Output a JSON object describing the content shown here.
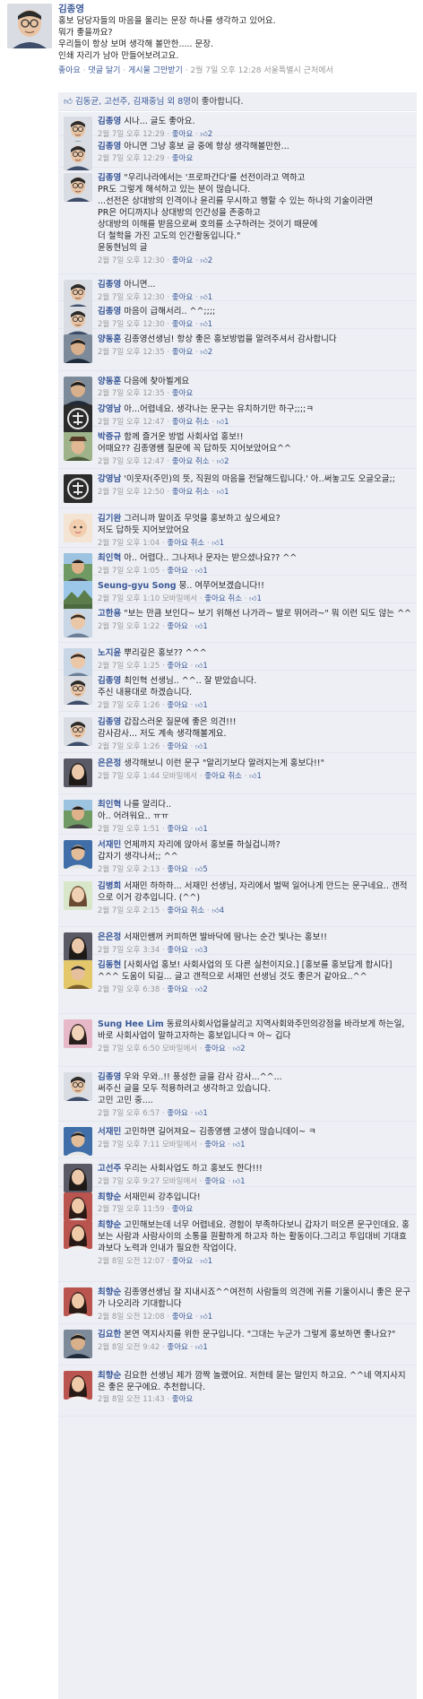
{
  "post": {
    "author": "김종영",
    "text": "홍보 담당자들의 마음을 울리는 문장 하나를 생각하고 있어요.\n뭐가 좋을까요?\n우리들이 항상 보며 생각해 볼만한..... 문장.\n인쇄 자리가 남아 만들어보려고요.",
    "actions": {
      "like": "좋아요",
      "comment": "댓글 달기",
      "unfollow": "게시물 그만받기",
      "time": "2월 7일 오후 12:28",
      "place": "서울특별시 근처에서"
    }
  },
  "likes_bar": {
    "names": "김동균, 고선주, 김재중님",
    "others": "외 8명",
    "suffix": "이 좋아합니다."
  },
  "colors": {
    "link": "#3b5998",
    "comment_bg": "#edeff4",
    "meta": "#999999"
  },
  "comments": [
    {
      "author": "김종영",
      "text": "시나... 글도 좋아요.",
      "time": "2월 7일 오후 12:29",
      "like": "좋아요",
      "count": "2",
      "avatar": "man-glasses"
    },
    {
      "author": "김종영",
      "text": "아니면 그냥 홍보 글 중에 항상 생각해볼만한...",
      "time": "2월 7일 오후 12:29",
      "like": "좋아요",
      "count": "",
      "avatar": "man-glasses"
    },
    {
      "author": "김종영",
      "text": "\"우리나라에서는 '프로파간다'를 선전이라고 역하고\nPR도 그렇게 해석하고 있는 분이 많습니다.\n...선전은 상대방의 인격이나 윤리를 무시하고 행할 수 있는 하나의 기술이라면\nPR은 어디까지나 상대방의 인간성을 존중하고\n상대방의 이해를 받음으로써 호의를 소구하려는 것이기 때문에\n더 철학을 가진 고도의 인간활동입니다.\"\n윤동현님의 글",
      "time": "2월 7일 오후 12:30",
      "like": "좋아요",
      "count": "2",
      "avatar": "man-glasses"
    },
    {
      "author": "김종영",
      "text": "아니면...",
      "time": "2월 7일 오후 12:30",
      "like": "좋아요",
      "count": "1",
      "avatar": "man-glasses"
    },
    {
      "author": "김종영",
      "text": "마음이 급해서리.. ^^;;;;",
      "time": "2월 7일 오후 12:30",
      "like": "좋아요",
      "count": "1",
      "avatar": "man-glasses"
    },
    {
      "author": "양동훈",
      "text": "김종영선생님! 항상 좋은 홍보방법을 알려주셔서 감사합니다",
      "time": "2월 7일 오후 12:35",
      "like": "좋아요",
      "count": "2",
      "avatar": "man-dark"
    },
    {
      "author": "양동훈",
      "text": "다음에 찾아뵐게요",
      "time": "2월 7일 오후 12:35",
      "like": "좋아요",
      "count": "",
      "avatar": "man-dark"
    },
    {
      "author": "강영남",
      "text": "아...어렵네요. 생각나는 문구는 유치하기만 하구;;;;ㅋ",
      "time": "2월 7일 오후 12:47",
      "like": "좋아요 취소",
      "count": "1",
      "avatar": "logo-dark"
    },
    {
      "author": "박증규",
      "text": "함께 즐거운 방법 사회사업 홍보!!\n어때요?? 김종영쌤 질문에 꼭 답하듯 지어보았어요^^",
      "time": "2월 7일 오후 12:47",
      "like": "좋아요 취소",
      "count": "2",
      "avatar": "man-hat"
    },
    {
      "author": "강영남",
      "text": "'이웃자(주민)의 뜻, 직원의 마음을 전달해드립니다.' 아..써놓고도 오글오글;;",
      "time": "2월 7일 오후 12:50",
      "like": "좋아요 취소",
      "count": "1",
      "avatar": "logo-dark"
    },
    {
      "author": "김기완",
      "text": "그러니까 말이죠 무엇을 홍보하고 싶으세요?\n저도 답하듯 지어보았어요",
      "time": "2월 7일 오후 1:04",
      "like": "좋아요 취소",
      "count": "1",
      "avatar": "baby"
    },
    {
      "author": "최인혁",
      "text": "아.. 어렵다.. 그나저나 문자는 받으셨나요?? ^^",
      "time": "2월 7일 오후 1:05",
      "like": "좋아요",
      "count": "1",
      "avatar": "man-outdoor"
    },
    {
      "author": "Seung-gyu Song",
      "text": "뭉.. 여쭈어보겠습니다!!",
      "time": "2월 7일 오후 1:10 모바일에서",
      "like": "좋아요 취소",
      "count": "1",
      "avatar": "landscape"
    },
    {
      "author": "고한용",
      "text": "\"보는 만큼 보인다~ 보기 위해선 나가라~ 발로 뛰어라~\" 뭐 이런 되도 않는 ^^",
      "time": "2월 7일 오후 1:22",
      "like": "좋아요",
      "count": "1",
      "avatar": "man-light"
    },
    {
      "author": "노지윤",
      "text": "뿌리깊은 홍보?? ^^^",
      "time": "2월 7일 오후 1:25",
      "like": "좋아요",
      "count": "1",
      "avatar": "man-light"
    },
    {
      "author": "김종영",
      "text": "최인혁 선생님.. ^^.. 잘 받았습니다.\n주신 내용대로 하겠습니다.",
      "time": "2월 7일 오후 1:26",
      "like": "좋아요",
      "count": "1",
      "avatar": "man-glasses"
    },
    {
      "author": "김종영",
      "text": "갑잡스러운 질문에 좋은 의견!!!\n감사감사... 저도 계속 생각해볼게요.",
      "time": "2월 7일 오후 1:26",
      "like": "좋아요",
      "count": "1",
      "avatar": "man-glasses"
    },
    {
      "author": "은은정",
      "text": "생각해보니 이런 문구 \"알리기보다 알려지는게 홍보다!!\"",
      "time": "2월 7일 오후 1:44 모바일에서",
      "like": "좋아요 취소",
      "count": "1",
      "avatar": "woman-dark"
    },
    {
      "author": "최인혁",
      "text": "나를 알리다..\n아.. 어려워요.. ㅠㅠ",
      "time": "2월 7일 오후 1:51",
      "like": "좋아요",
      "count": "1",
      "avatar": "man-outdoor"
    },
    {
      "author": "서재민",
      "text": "언제까지 자리에 앉아서 홍보를 하실겁니까?\n갑자기 생각나서;; ^^",
      "time": "2월 7일 오후 2:13",
      "like": "좋아요",
      "count": "5",
      "avatar": "man-blue"
    },
    {
      "author": "김병희",
      "text": "서재민 하하하... 서재민 선생님, 자리에서 벌떡 일어나게 만드는 문구네요.. 갠적으로 이거 강추입니다. (^^)",
      "time": "2월 7일 오후 2:15",
      "like": "좋아요 취소",
      "count": "4",
      "avatar": "woman-light"
    },
    {
      "author": "은은정",
      "text": "서재민쌤꺼 커피하면 발바닥에 땀나는 순간 빛나는 홍보!!",
      "time": "2월 7일 오후 3:34",
      "like": "좋아요",
      "count": "3",
      "avatar": "woman-dark"
    },
    {
      "author": "김동현",
      "text": "[사회사업 홍보! 사회사업의 또 다른 실천이지요.] [홍보를 홍보답게 합시다] ^^^ 도움이 되길... 글고 갠적으로 서재민 선생님 것도 좋은거 같아요..^^",
      "time": "2월 7일 오후 6:38",
      "like": "좋아요",
      "count": "2",
      "avatar": "man-yellow"
    },
    {
      "author": "Sung Hee Lim",
      "text": "동료의사회사업을살리고 지역사회와주민의강점을 바라보게 하는일, 바로 사회사업이 말하고자하는 홍보입니다ㅋ 아~ 깁다",
      "time": "2월 7일 오후 6:50 모바일에서",
      "like": "좋아요",
      "count": "2",
      "avatar": "woman-pink"
    },
    {
      "author": "김종영",
      "text": "우와 우와..!! 풍성한 글을 감사 감사...^^...\n써주신 글을 모두 적용하려고 생각하고 있습니다.\n고민 고민 중....",
      "time": "2월 7일 오후 6:57",
      "like": "좋아요",
      "count": "1",
      "avatar": "man-glasses"
    },
    {
      "author": "서재민",
      "text": "고민하면 길어져요~ 김종영쌤 고생이 많습니데이~ ㅋ",
      "time": "2월 7일 오후 7:11 모바일에서",
      "like": "좋아요",
      "count": "1",
      "avatar": "man-blue"
    },
    {
      "author": "고선주",
      "text": "우리는 사회사업도 하고 홍보도 한다!!!",
      "time": "2월 7일 오후 9:27 모바일에서",
      "like": "좋아요",
      "count": "1",
      "avatar": "woman-dark"
    },
    {
      "author": "최향순",
      "text": "서재민씨 강추입니다!",
      "time": "2월 7일 오후 11:59",
      "like": "좋아요",
      "count": "",
      "avatar": "woman-red"
    },
    {
      "author": "최향순",
      "text": "고민해보는데 너무 어렵네요. 경험이 부족하다보니 갑자기 떠오른 문구인데요. 홍보는 사람과 사람사이의 소통을 원활하게 하고자 하는 활동이다.그리고 투입대비 기대효과보다 노력과 인내가 필요한 작업이다.",
      "time": "2월 8일 오전 12:07",
      "like": "좋아요",
      "count": "1",
      "avatar": "woman-red"
    },
    {
      "author": "최향순",
      "text": "김종영선생님 잘 지내시죠^^여전히 사람들의 의견에 귀를 기울이시니 좋은 문구가 나오리라 기대합니다",
      "time": "2월 8일 오전 12:08",
      "like": "좋아요",
      "count": "1",
      "avatar": "woman-red"
    },
    {
      "author": "김요한",
      "text": "본연 역지사지를 위한 문구입니다. \"그대는 누군가 그렇게 홍보하면 좋나요?\"",
      "time": "2월 8일 오전 9:42",
      "like": "좋아요",
      "count": "1",
      "avatar": "man-dark"
    },
    {
      "author": "최향순",
      "text": "김요한 선생님 제가 깜짝 놀랬어요. 저한테 묻는 말인지 하고요. ^^네 역지사지은 좋은 문구에요. 추천합니다.",
      "time": "2월 8일 오전 11:43",
      "like": "좋아요",
      "count": "",
      "avatar": "woman-red"
    }
  ]
}
